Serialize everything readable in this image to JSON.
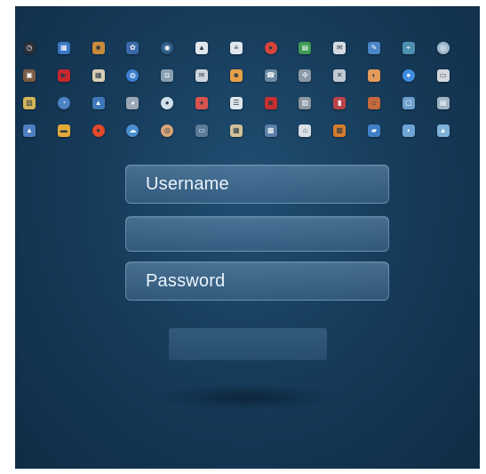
{
  "login": {
    "username_placeholder": "Username",
    "middle_field_value": "",
    "password_placeholder": "Password",
    "submit_label": ""
  },
  "icons": [
    {
      "name": "clock-icon",
      "color": "#2b2f36",
      "glyph": "◷",
      "shape": "round"
    },
    {
      "name": "calendar-icon",
      "color": "#3a78c4",
      "glyph": "▦",
      "shape": "square"
    },
    {
      "name": "contacts-icon",
      "color": "#c98a3a",
      "glyph": "☻",
      "shape": "square"
    },
    {
      "name": "photos-icon",
      "color": "#3a6aa8",
      "glyph": "✿",
      "shape": "square"
    },
    {
      "name": "compass-icon",
      "color": "#2e5d86",
      "glyph": "◉",
      "shape": "round"
    },
    {
      "name": "lock-icon",
      "color": "#e0e6ec",
      "glyph": "▲",
      "shape": "square"
    },
    {
      "name": "document-icon",
      "color": "#dfe6ee",
      "glyph": "≡",
      "shape": "square"
    },
    {
      "name": "record-icon",
      "color": "#d8443a",
      "glyph": "●",
      "shape": "round"
    },
    {
      "name": "spreadsheet-icon",
      "color": "#3e9a55",
      "glyph": "▤",
      "shape": "square"
    },
    {
      "name": "mail-icon",
      "color": "#d5dbe2",
      "glyph": "✉",
      "shape": "square"
    },
    {
      "name": "notes-icon",
      "color": "#4a86c6",
      "glyph": "✎",
      "shape": "square"
    },
    {
      "name": "map-icon",
      "color": "#4d8fb0",
      "glyph": "⌖",
      "shape": "square"
    },
    {
      "name": "globe-icon",
      "color": "#9fb8cc",
      "glyph": "◎",
      "shape": "round"
    },
    {
      "name": "presentation-icon",
      "color": "#7a5c44",
      "glyph": "▣",
      "shape": "square"
    },
    {
      "name": "video-icon",
      "color": "#c8262d",
      "glyph": "▶",
      "shape": "square"
    },
    {
      "name": "calendar-grid-icon",
      "color": "#d9cdb4",
      "glyph": "▦",
      "shape": "square"
    },
    {
      "name": "browser-icon",
      "color": "#3d7fd0",
      "glyph": "◍",
      "shape": "round"
    },
    {
      "name": "camera-icon",
      "color": "#8aa0b2",
      "glyph": "◘",
      "shape": "square"
    },
    {
      "name": "envelope-icon",
      "color": "#cfd6de",
      "glyph": "✉",
      "shape": "square"
    },
    {
      "name": "contact-card-icon",
      "color": "#e8a048",
      "glyph": "☻",
      "shape": "square"
    },
    {
      "name": "phone-icon",
      "color": "#6c8aa4",
      "glyph": "☎",
      "shape": "square"
    },
    {
      "name": "settings-icon",
      "color": "#8c9aa8",
      "glyph": "✣",
      "shape": "square"
    },
    {
      "name": "fan-icon",
      "color": "#c2cbd3",
      "glyph": "✕",
      "shape": "square"
    },
    {
      "name": "gamepad-icon",
      "color": "#e39a5a",
      "glyph": "◐",
      "shape": "square"
    },
    {
      "name": "chat-icon",
      "color": "#3f8ee0",
      "glyph": "●",
      "shape": "round"
    },
    {
      "name": "battery-icon",
      "color": "#d4d8dc",
      "glyph": "▭",
      "shape": "square"
    },
    {
      "name": "gallery-icon",
      "color": "#d2b45a",
      "glyph": "▨",
      "shape": "square"
    },
    {
      "name": "dashboard-icon",
      "color": "#4a82c4",
      "glyph": "◔",
      "shape": "round"
    },
    {
      "name": "image-icon",
      "color": "#3e78b8",
      "glyph": "▲",
      "shape": "square"
    },
    {
      "name": "podcast-icon",
      "color": "#9aa8b6",
      "glyph": "◕",
      "shape": "square"
    },
    {
      "name": "message-icon",
      "color": "#cfe0ec",
      "glyph": "●",
      "shape": "round"
    },
    {
      "name": "badge-icon",
      "color": "#d9534f",
      "glyph": "♦",
      "shape": "square"
    },
    {
      "name": "list-icon",
      "color": "#dfe6ec",
      "glyph": "☰",
      "shape": "square"
    },
    {
      "name": "alarm-icon",
      "color": "#c8302f",
      "glyph": "◙",
      "shape": "square"
    },
    {
      "name": "books-icon",
      "color": "#8a96a2",
      "glyph": "▥",
      "shape": "square"
    },
    {
      "name": "journal-icon",
      "color": "#b9434a",
      "glyph": "▮",
      "shape": "square"
    },
    {
      "name": "archive-icon",
      "color": "#c46a3c",
      "glyph": "⌂",
      "shape": "square"
    },
    {
      "name": "frame-icon",
      "color": "#6d9fce",
      "glyph": "▢",
      "shape": "square"
    },
    {
      "name": "printer-icon",
      "color": "#9fb3c2",
      "glyph": "▤",
      "shape": "square"
    },
    {
      "name": "shopping-bag-icon",
      "color": "#4d7fc2",
      "glyph": "▲",
      "shape": "square"
    },
    {
      "name": "wallet-icon",
      "color": "#e2a93a",
      "glyph": "▬",
      "shape": "square"
    },
    {
      "name": "fire-icon",
      "color": "#e14a2a",
      "glyph": "●",
      "shape": "round"
    },
    {
      "name": "cloud-icon",
      "color": "#4a8fd0",
      "glyph": "☁",
      "shape": "round"
    },
    {
      "name": "disc-icon",
      "color": "#d9a679",
      "glyph": "◎",
      "shape": "round"
    },
    {
      "name": "film-icon",
      "color": "#5a7a96",
      "glyph": "▭",
      "shape": "square"
    },
    {
      "name": "bookmark-icon",
      "color": "#d2c39a",
      "glyph": "▦",
      "shape": "square"
    },
    {
      "name": "apps-icon",
      "color": "#5b7fa8",
      "glyph": "▩",
      "shape": "square"
    },
    {
      "name": "home-icon",
      "color": "#d9dfe5",
      "glyph": "⌂",
      "shape": "square"
    },
    {
      "name": "store-icon",
      "color": "#d67d2e",
      "glyph": "▩",
      "shape": "square"
    },
    {
      "name": "folder-icon",
      "color": "#3f7fc6",
      "glyph": "▰",
      "shape": "square"
    },
    {
      "name": "search-icon",
      "color": "#6ea3d6",
      "glyph": "◗",
      "shape": "square"
    },
    {
      "name": "weather-icon",
      "color": "#7fb1d8",
      "glyph": "▲",
      "shape": "square"
    }
  ]
}
